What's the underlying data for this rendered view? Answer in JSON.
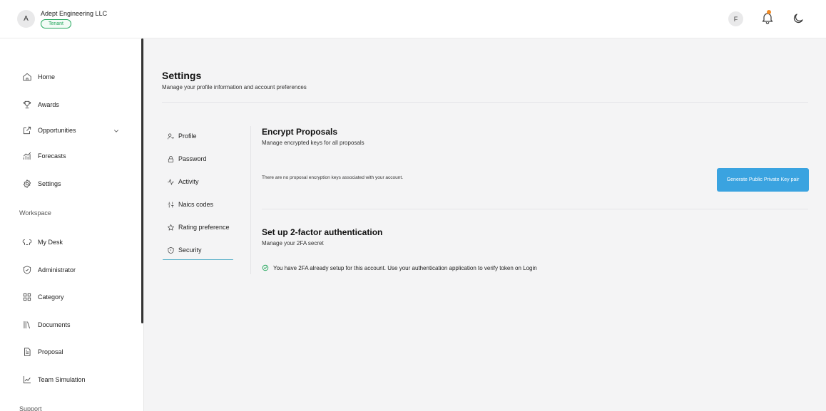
{
  "header": {
    "avatar_initial": "A",
    "org_name": "Adept Engineering LLC",
    "tenant_badge": "Tenant",
    "user_initial": "F",
    "notification_dot_color": "#f08a24"
  },
  "sidebar": {
    "items": [
      {
        "label": "Home",
        "icon": "home-icon"
      },
      {
        "label": "Awards",
        "icon": "trophy-icon"
      },
      {
        "label": "Opportunities",
        "icon": "external-link-icon"
      },
      {
        "label": "Forecasts",
        "icon": "chart-icon"
      },
      {
        "label": "Settings",
        "icon": "gear-icon"
      }
    ],
    "workspace_label": "Workspace",
    "workspace_items": [
      {
        "label": "My Desk",
        "icon": "desk-icon"
      },
      {
        "label": "Administrator",
        "icon": "shield-icon"
      },
      {
        "label": "Category",
        "icon": "category-icon"
      },
      {
        "label": "Documents",
        "icon": "library-icon"
      },
      {
        "label": "Proposal",
        "icon": "file-icon"
      },
      {
        "label": "Team Simulation",
        "icon": "line-chart-icon"
      }
    ],
    "support_label": "Support"
  },
  "page": {
    "title": "Settings",
    "subtitle": "Manage your profile information and account preferences"
  },
  "tabs": [
    {
      "label": "Profile",
      "icon": "user-key-icon"
    },
    {
      "label": "Password",
      "icon": "lock-icon"
    },
    {
      "label": "Activity",
      "icon": "activity-icon"
    },
    {
      "label": "Naics codes",
      "icon": "code-icon"
    },
    {
      "label": "Rating preference",
      "icon": "star-icon"
    },
    {
      "label": "Security",
      "icon": "shield-icon",
      "active": true
    }
  ],
  "encrypt": {
    "title": "Encrypt Proposals",
    "subtitle": "Manage encrypted keys for all proposals",
    "empty_message": "There are no proposal encryption keys associated with your account.",
    "button_label": "Generate Public Private Key pair"
  },
  "twofa": {
    "title": "Set up 2-factor authentication",
    "subtitle": "Manage your 2FA secret",
    "status": "You have 2FA already setup for this account. Use your authentication application to verify token on Login"
  },
  "colors": {
    "accent": "#3aa3e0",
    "success": "#20a65a",
    "active_tab_underline": "#5ab0c8"
  }
}
